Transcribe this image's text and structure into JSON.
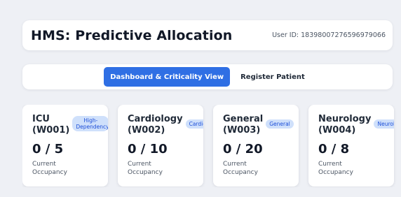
{
  "header": {
    "title": "HMS: Predictive Allocation",
    "user_id": "User ID: 18398007276596979066"
  },
  "tabs": [
    {
      "label": "Dashboard & Criticality View",
      "active": true
    },
    {
      "label": "Register Patient",
      "active": false
    }
  ],
  "wards": [
    {
      "name": "ICU",
      "code": "(W001)",
      "badge": "High-Dependency",
      "occupancy": "0 / 5",
      "occupancy_label": "Current Occupancy"
    },
    {
      "name": "Cardiology",
      "code": "(W002)",
      "badge": "Cardiology",
      "occupancy": "0 / 10",
      "occupancy_label": "Current Occupancy"
    },
    {
      "name": "General",
      "code": "(W003)",
      "badge": "General",
      "occupancy": "0 / 20",
      "occupancy_label": "Current Occupancy"
    },
    {
      "name": "Neurology",
      "code": "(W004)",
      "badge": "Neurology",
      "occupancy": "0 / 8",
      "occupancy_label": "Current Occupancy"
    }
  ],
  "colors": {
    "accent": "#2f6fe4",
    "badge_bg": "#cfe0fb",
    "badge_text": "#1d4ed8",
    "page_bg": "#eef0f5"
  }
}
